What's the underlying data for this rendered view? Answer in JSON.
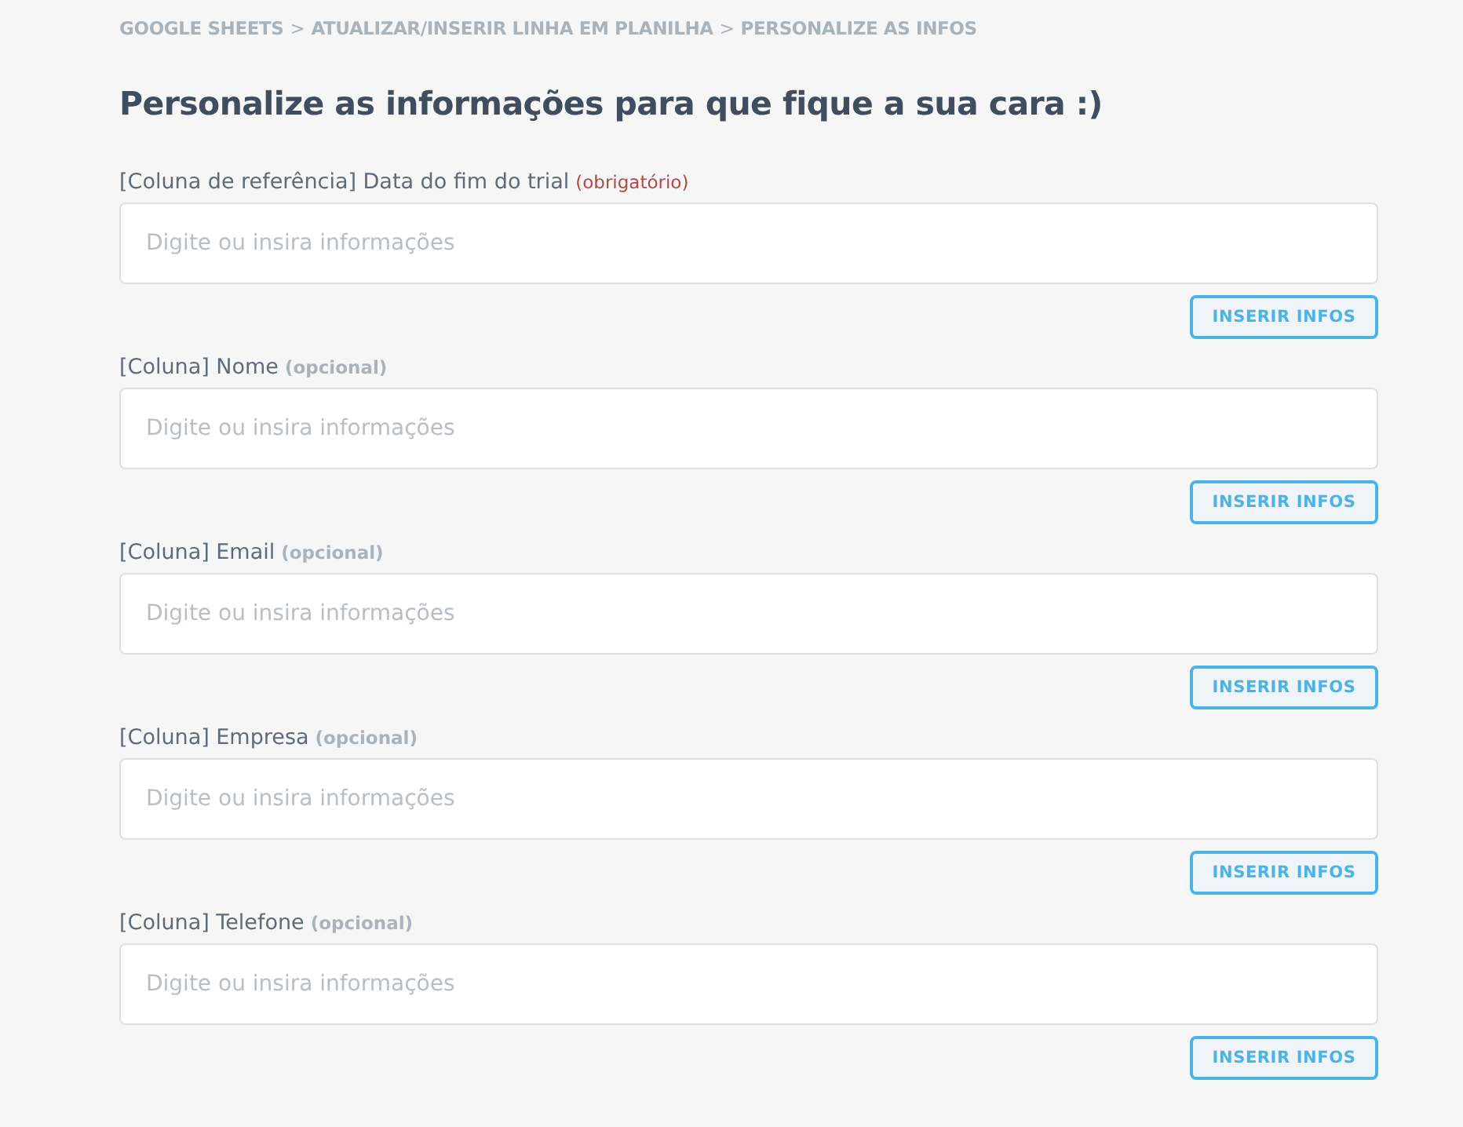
{
  "breadcrumb": {
    "separator": ">",
    "items": [
      "GOOGLE SHEETS",
      "ATUALIZAR/INSERIR LINHA EM PLANILHA",
      "PERSONALIZE AS INFOS"
    ]
  },
  "title": "Personalize as informações para que fique a sua cara :)",
  "fields": [
    {
      "label": "[Coluna de referência] Data do fim do trial",
      "tag": "(obrigatório)",
      "kind": "required",
      "placeholder": "Digite ou insira informações",
      "button": "INSERIR INFOS"
    },
    {
      "label": "[Coluna] Nome",
      "tag": "(opcional)",
      "kind": "optional",
      "placeholder": "Digite ou insira informações",
      "button": "INSERIR INFOS"
    },
    {
      "label": "[Coluna] Email",
      "tag": "(opcional)",
      "kind": "optional",
      "placeholder": "Digite ou insira informações",
      "button": "INSERIR INFOS"
    },
    {
      "label": "[Coluna] Empresa",
      "tag": "(opcional)",
      "kind": "optional",
      "placeholder": "Digite ou insira informações",
      "button": "INSERIR INFOS"
    },
    {
      "label": "[Coluna] Telefone",
      "tag": "(opcional)",
      "kind": "optional",
      "placeholder": "Digite ou insira informações",
      "button": "INSERIR INFOS"
    }
  ]
}
